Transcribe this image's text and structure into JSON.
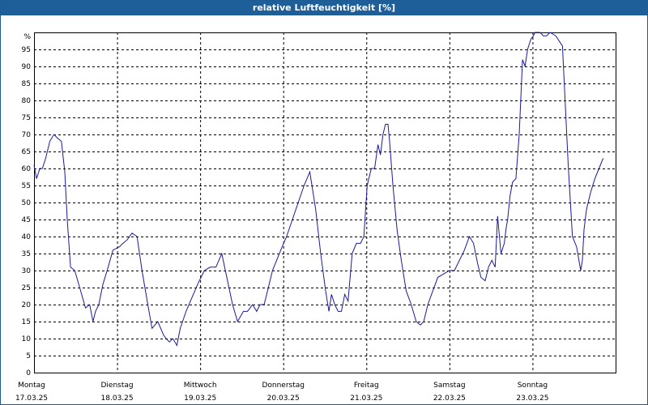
{
  "chart_data": {
    "type": "line",
    "title": "relative Luftfeuchtigkeit [%]",
    "ylabel": "%",
    "ylim": [
      0,
      100
    ],
    "yticks": [
      0,
      5,
      10,
      15,
      20,
      25,
      30,
      35,
      40,
      45,
      50,
      55,
      60,
      65,
      70,
      75,
      80,
      85,
      90,
      95
    ],
    "xlim": [
      0,
      7
    ],
    "grid": true,
    "days": [
      {
        "weekday": "Montag",
        "date": "17.03.25"
      },
      {
        "weekday": "Dienstag",
        "date": "18.03.25"
      },
      {
        "weekday": "Mittwoch",
        "date": "19.03.25"
      },
      {
        "weekday": "Donnerstag",
        "date": "20.03.25"
      },
      {
        "weekday": "Freitag",
        "date": "21.03.25"
      },
      {
        "weekday": "Samstag",
        "date": "22.03.25"
      },
      {
        "weekday": "Sonntag",
        "date": "23.03.25"
      }
    ],
    "line_color": "#1a1a9c",
    "x": [
      0.0,
      0.03,
      0.07,
      0.1,
      0.14,
      0.19,
      0.24,
      0.28,
      0.33,
      0.37,
      0.4,
      0.44,
      0.49,
      0.55,
      0.62,
      0.67,
      0.71,
      0.74,
      0.78,
      0.83,
      0.88,
      0.95,
      1.03,
      1.07,
      1.12,
      1.18,
      1.24,
      1.3,
      1.37,
      1.42,
      1.49,
      1.56,
      1.59,
      1.63,
      1.67,
      1.72,
      1.76,
      1.83,
      1.9,
      1.97,
      2.05,
      2.12,
      2.19,
      2.26,
      2.32,
      2.39,
      2.45,
      2.52,
      2.57,
      2.63,
      2.68,
      2.72,
      2.77,
      2.82,
      2.87,
      2.92,
      2.97,
      3.04,
      3.11,
      3.18,
      3.25,
      3.32,
      3.39,
      3.45,
      3.51,
      3.55,
      3.58,
      3.62,
      3.66,
      3.7,
      3.74,
      3.78,
      3.83,
      3.88,
      3.93,
      3.97,
      4.01,
      4.06,
      4.1,
      4.14,
      4.17,
      4.2,
      4.23,
      4.26,
      4.28,
      4.32,
      4.37,
      4.42,
      4.48,
      4.54,
      4.6,
      4.65,
      4.69,
      4.74,
      4.8,
      4.86,
      4.93,
      5.0,
      5.06,
      5.12,
      5.18,
      5.24,
      5.29,
      5.34,
      5.38,
      5.43,
      5.47,
      5.51,
      5.55,
      5.58,
      5.62,
      5.66,
      5.68,
      5.7,
      5.73,
      5.76,
      5.8,
      5.84,
      5.88,
      5.91,
      5.94,
      5.98,
      6.01,
      6.03,
      6.06,
      6.09,
      6.13,
      6.17,
      6.21,
      6.28,
      6.36,
      6.43,
      6.48,
      6.53,
      6.58,
      6.6,
      6.62,
      6.65,
      6.7,
      6.75,
      6.8,
      6.85,
      6.9,
      6.95,
      7.0
    ],
    "y": [
      61,
      57,
      60,
      60,
      63,
      68,
      70,
      69,
      68,
      59,
      45,
      31,
      30,
      25,
      19,
      20,
      15,
      18,
      20,
      26,
      30,
      36,
      37,
      38,
      39,
      41,
      40,
      30,
      20,
      13,
      15,
      11,
      10,
      9,
      10,
      8,
      13,
      18,
      22,
      26,
      30,
      31,
      31,
      35,
      28,
      20,
      15,
      18,
      18,
      20,
      18,
      20,
      20,
      25,
      30,
      33,
      36,
      40,
      45,
      50,
      55,
      59,
      48,
      35,
      24,
      18,
      23,
      20,
      18,
      18,
      23,
      21,
      35,
      38,
      38,
      40,
      55,
      60,
      60,
      67,
      64,
      70,
      73,
      73,
      68,
      55,
      42,
      33,
      24,
      20,
      15,
      14,
      15,
      20,
      24,
      28,
      29,
      30,
      30,
      33,
      36,
      40,
      38,
      32,
      28,
      27,
      31,
      33,
      31,
      46,
      35,
      38,
      42,
      45,
      52,
      56,
      57,
      70,
      92,
      90,
      95,
      98,
      99,
      100,
      100,
      100,
      99,
      99,
      100,
      99,
      96,
      61,
      40,
      37,
      30,
      33,
      42,
      48,
      53,
      57,
      60,
      63
    ]
  }
}
